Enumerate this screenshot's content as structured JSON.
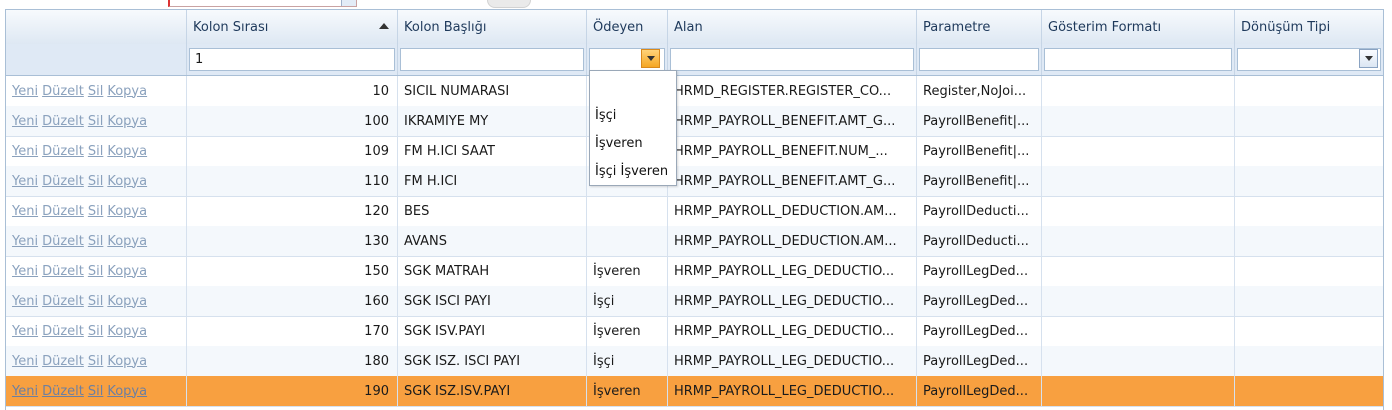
{
  "columns": {
    "actions": "",
    "kolon_sirasi": "Kolon Sırası",
    "kolon_basligi": "Kolon Başlığı",
    "odeyen": "Ödeyen",
    "alan": "Alan",
    "parametre": "Parametre",
    "gosterim_formati": "Gösterim Formatı",
    "donusum_tipi": "Dönüşüm Tipi"
  },
  "filter": {
    "kolon_sirasi": "1"
  },
  "row_actions": {
    "new": "Yeni",
    "edit": "Düzelt",
    "delete": "Sil",
    "copy": "Kopya"
  },
  "dropdown_options": [
    "İşçi",
    "İşveren",
    "İşçi İşveren"
  ],
  "rows": [
    {
      "sira": "10",
      "baslik": "SICIL NUMARASI",
      "odeyen": "",
      "alan": "HRMD_REGISTER.REGISTER_CO...",
      "parametre": "Register,NoJoi..."
    },
    {
      "sira": "100",
      "baslik": "IKRAMIYE MY",
      "odeyen": "",
      "alan": "HRMP_PAYROLL_BENEFIT.AMT_G...",
      "parametre": "PayrollBenefit|..."
    },
    {
      "sira": "109",
      "baslik": "FM H.ICI SAAT",
      "odeyen": "",
      "alan": "HRMP_PAYROLL_BENEFIT.NUM_...",
      "parametre": "PayrollBenefit|..."
    },
    {
      "sira": "110",
      "baslik": "FM H.ICI",
      "odeyen": "",
      "alan": "HRMP_PAYROLL_BENEFIT.AMT_G...",
      "parametre": "PayrollBenefit|..."
    },
    {
      "sira": "120",
      "baslik": "BES",
      "odeyen": "",
      "alan": "HRMP_PAYROLL_DEDUCTION.AM...",
      "parametre": "PayrollDeducti..."
    },
    {
      "sira": "130",
      "baslik": "AVANS",
      "odeyen": "",
      "alan": "HRMP_PAYROLL_DEDUCTION.AM...",
      "parametre": "PayrollDeducti..."
    },
    {
      "sira": "150",
      "baslik": "SGK MATRAH",
      "odeyen": "İşveren",
      "alan": "HRMP_PAYROLL_LEG_DEDUCTIO...",
      "parametre": "PayrollLegDed..."
    },
    {
      "sira": "160",
      "baslik": "SGK ISCI PAYI",
      "odeyen": "İşçi",
      "alan": "HRMP_PAYROLL_LEG_DEDUCTIO...",
      "parametre": "PayrollLegDed..."
    },
    {
      "sira": "170",
      "baslik": "SGK ISV.PAYI",
      "odeyen": "İşveren",
      "alan": "HRMP_PAYROLL_LEG_DEDUCTIO...",
      "parametre": "PayrollLegDed..."
    },
    {
      "sira": "180",
      "baslik": "SGK ISZ. ISCI PAYI",
      "odeyen": "İşçi",
      "alan": "HRMP_PAYROLL_LEG_DEDUCTIO...",
      "parametre": "PayrollLegDed..."
    },
    {
      "sira": "190",
      "baslik": "SGK ISZ.ISV.PAYI",
      "odeyen": "İşveren",
      "alan": "HRMP_PAYROLL_LEG_DEDUCTIO...",
      "parametre": "PayrollLegDed..."
    }
  ],
  "selected_row_color": "#f8a040",
  "dropdown_button_color": "#f5a623",
  "icons": {
    "sort": "sort-ascending-icon",
    "dropdown": "chevron-down-icon"
  }
}
